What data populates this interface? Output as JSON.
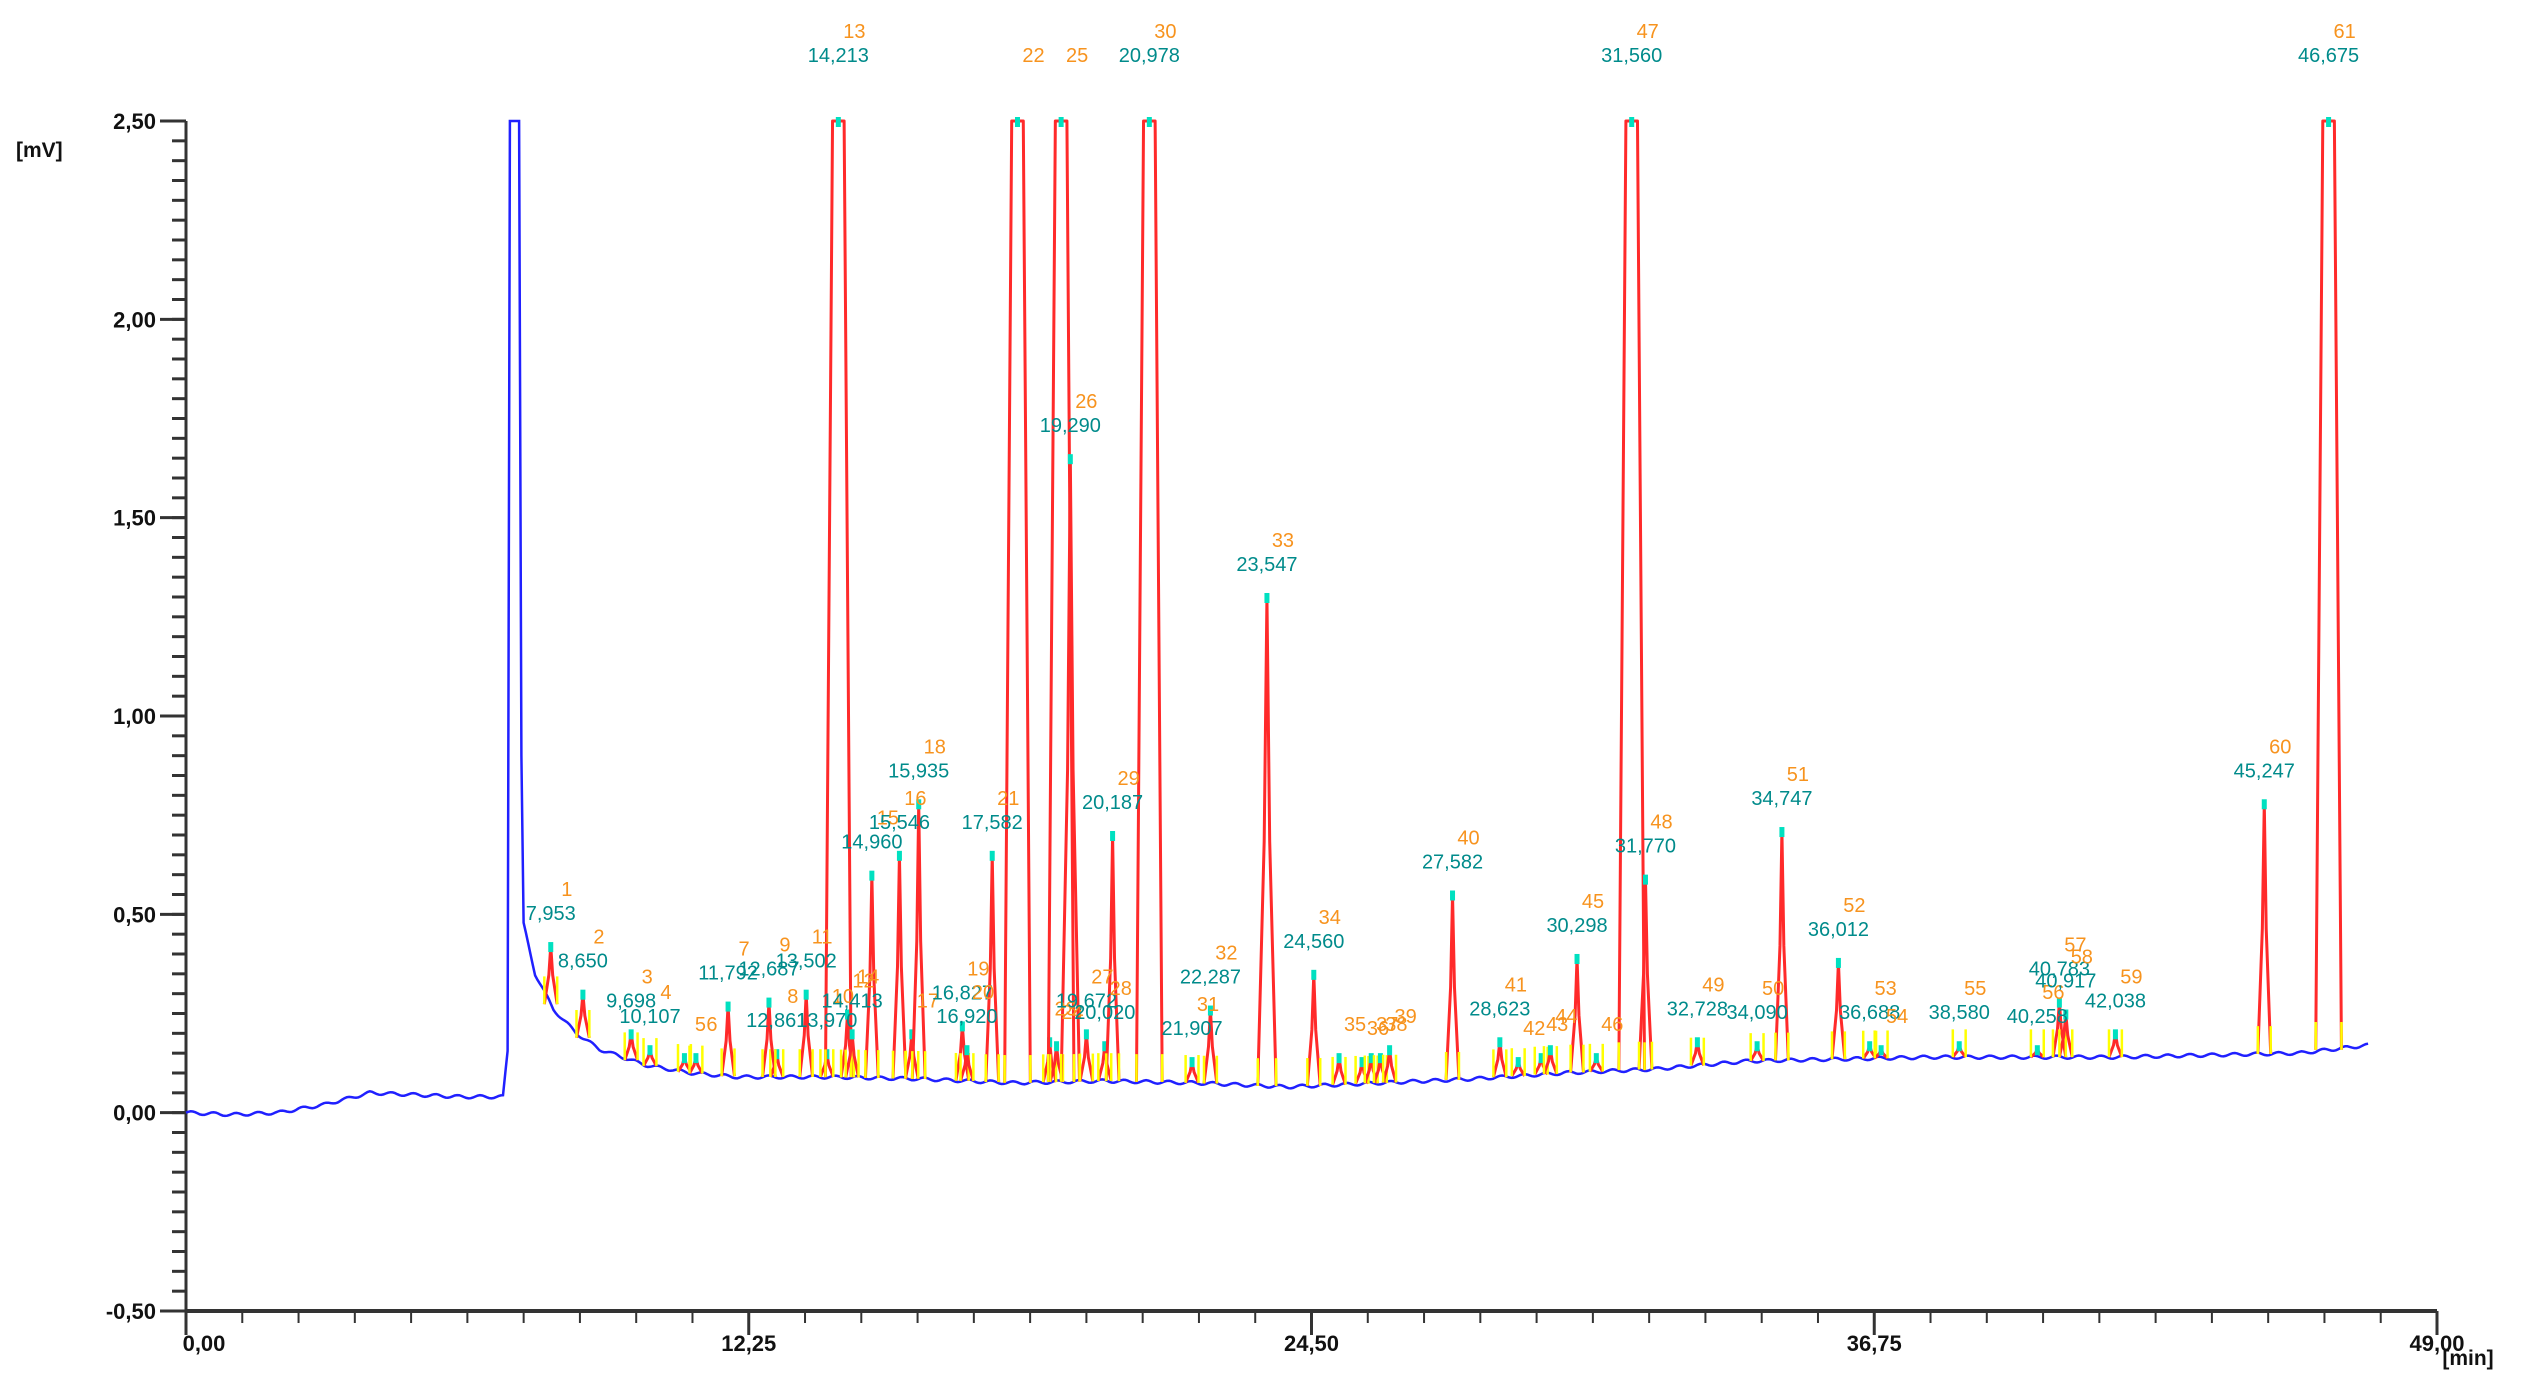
{
  "chart_data": {
    "type": "line",
    "title": "",
    "xlabel": "[min]",
    "ylabel": "[mV]",
    "xlim": [
      0,
      49
    ],
    "ylim": [
      -0.5,
      2.5
    ],
    "x_ticks": [
      0,
      12.25,
      24.5,
      36.75,
      49
    ],
    "x_tick_labels": [
      "0,00",
      "12,25",
      "24,50",
      "36,75",
      "49,00"
    ],
    "y_ticks": [
      2.5,
      2.0,
      1.5,
      1.0,
      0.5,
      0.0,
      -0.5
    ],
    "y_tick_labels": [
      "2,50",
      "2,00",
      "1,50",
      "1,00",
      "0,50",
      "0,00",
      "-0,50"
    ],
    "grid": false,
    "colors": {
      "baseline": "#2020ff",
      "peak": "#ff2a2a",
      "marker": "#ffff00",
      "apex": "#00e0c0",
      "number": "#f7931e",
      "rt": "#008b8b",
      "axis": "#333333"
    },
    "solvent_front": {
      "start": 7.0,
      "end": 7.27,
      "height": 2.5
    },
    "baseline": [
      [
        0,
        0.0
      ],
      [
        1,
        -0.005
      ],
      [
        2,
        0.0
      ],
      [
        3,
        0.02
      ],
      [
        4,
        0.05
      ],
      [
        5,
        0.045
      ],
      [
        6,
        0.04
      ],
      [
        6.9,
        0.04
      ],
      [
        7.3,
        0.5
      ],
      [
        7.6,
        0.35
      ],
      [
        8,
        0.26
      ],
      [
        8.5,
        0.2
      ],
      [
        9,
        0.16
      ],
      [
        10,
        0.12
      ],
      [
        11,
        0.1
      ],
      [
        12,
        0.09
      ],
      [
        14,
        0.09
      ],
      [
        16,
        0.085
      ],
      [
        18,
        0.075
      ],
      [
        20,
        0.08
      ],
      [
        22,
        0.075
      ],
      [
        24,
        0.065
      ],
      [
        26,
        0.075
      ],
      [
        28,
        0.085
      ],
      [
        30,
        0.1
      ],
      [
        32,
        0.11
      ],
      [
        34,
        0.13
      ],
      [
        36,
        0.135
      ],
      [
        38,
        0.14
      ],
      [
        40,
        0.14
      ],
      [
        42,
        0.14
      ],
      [
        44,
        0.145
      ],
      [
        46,
        0.15
      ],
      [
        47.5,
        0.17
      ]
    ],
    "peaks": [
      {
        "n": "1",
        "rt": "7,953",
        "t": 7.94,
        "h": 0.42
      },
      {
        "n": "2",
        "rt": "8,650",
        "t": 8.64,
        "h": 0.3
      },
      {
        "n": "3",
        "rt": "9,698",
        "t": 9.69,
        "h": 0.2
      },
      {
        "n": "4",
        "rt": "10,107",
        "t": 10.1,
        "h": 0.16
      },
      {
        "n": "5",
        "rt": "",
        "t": 10.85,
        "h": 0.14
      },
      {
        "n": "6",
        "rt": "",
        "t": 11.1,
        "h": 0.14
      },
      {
        "n": "7",
        "rt": "11,792",
        "t": 11.8,
        "h": 0.27
      },
      {
        "n": "8",
        "rt": "12,861",
        "t": 12.86,
        "h": 0.15
      },
      {
        "n": "9",
        "rt": "12,687",
        "t": 12.69,
        "h": 0.28
      },
      {
        "n": "10",
        "rt": "13,970",
        "t": 13.95,
        "h": 0.15
      },
      {
        "n": "11",
        "rt": "13,502",
        "t": 13.5,
        "h": 0.3
      },
      {
        "n": "12",
        "rt": "",
        "t": 14.4,
        "h": 0.25
      },
      {
        "n": "13",
        "rt": "14,213",
        "t": 14.2,
        "h": 2.5
      },
      {
        "n": "14",
        "rt": "14,413",
        "t": 14.5,
        "h": 0.2
      },
      {
        "n": "15",
        "rt": "14,960",
        "t": 14.93,
        "h": 0.6
      },
      {
        "n": "16",
        "rt": "15,546",
        "t": 15.53,
        "h": 0.65
      },
      {
        "n": "17",
        "rt": "",
        "t": 15.8,
        "h": 0.2
      },
      {
        "n": "18",
        "rt": "15,935",
        "t": 15.95,
        "h": 0.78
      },
      {
        "n": "19",
        "rt": "16,827",
        "t": 16.9,
        "h": 0.22
      },
      {
        "n": "20",
        "rt": "16,920",
        "t": 17.0,
        "h": 0.16
      },
      {
        "n": "21",
        "rt": "17,582",
        "t": 17.55,
        "h": 0.65
      },
      {
        "n": "22",
        "rt": "",
        "t": 18.1,
        "h": 2.5
      },
      {
        "n": "23",
        "rt": "",
        "t": 18.8,
        "h": 0.18
      },
      {
        "n": "24",
        "rt": "",
        "t": 18.95,
        "h": 0.17
      },
      {
        "n": "25",
        "rt": "",
        "t": 19.05,
        "h": 2.5
      },
      {
        "n": "26",
        "rt": "19,290",
        "t": 19.25,
        "h": 1.65
      },
      {
        "n": "27",
        "rt": "19,672",
        "t": 19.6,
        "h": 0.2
      },
      {
        "n": "28",
        "rt": "20,020",
        "t": 20.0,
        "h": 0.17
      },
      {
        "n": "29",
        "rt": "20,187",
        "t": 20.17,
        "h": 0.7
      },
      {
        "n": "30",
        "rt": "20,978",
        "t": 20.97,
        "h": 2.5
      },
      {
        "n": "31",
        "rt": "21,907",
        "t": 21.9,
        "h": 0.13
      },
      {
        "n": "32",
        "rt": "22,287",
        "t": 22.3,
        "h": 0.26
      },
      {
        "n": "33",
        "rt": "23,547",
        "t": 23.53,
        "h": 1.3
      },
      {
        "n": "34",
        "rt": "24,560",
        "t": 24.55,
        "h": 0.35
      },
      {
        "n": "35",
        "rt": "",
        "t": 25.1,
        "h": 0.14
      },
      {
        "n": "36",
        "rt": "",
        "t": 25.6,
        "h": 0.13
      },
      {
        "n": "37",
        "rt": "",
        "t": 25.8,
        "h": 0.14
      },
      {
        "n": "38",
        "rt": "",
        "t": 26.0,
        "h": 0.14
      },
      {
        "n": "39",
        "rt": "",
        "t": 26.2,
        "h": 0.16
      },
      {
        "n": "40",
        "rt": "27,582",
        "t": 27.57,
        "h": 0.55
      },
      {
        "n": "41",
        "rt": "28,623",
        "t": 28.6,
        "h": 0.18
      },
      {
        "n": "42",
        "rt": "",
        "t": 29.0,
        "h": 0.13
      },
      {
        "n": "43",
        "rt": "",
        "t": 29.5,
        "h": 0.14
      },
      {
        "n": "44",
        "rt": "",
        "t": 29.7,
        "h": 0.16
      },
      {
        "n": "45",
        "rt": "30,298",
        "t": 30.28,
        "h": 0.39
      },
      {
        "n": "46",
        "rt": "",
        "t": 30.7,
        "h": 0.14
      },
      {
        "n": "47",
        "rt": "31,560",
        "t": 31.47,
        "h": 2.5
      },
      {
        "n": "48",
        "rt": "31,770",
        "t": 31.77,
        "h": 0.59
      },
      {
        "n": "49",
        "rt": "32,728",
        "t": 32.9,
        "h": 0.18
      },
      {
        "n": "50",
        "rt": "34,090",
        "t": 34.2,
        "h": 0.17
      },
      {
        "n": "51",
        "rt": "34,747",
        "t": 34.74,
        "h": 0.71
      },
      {
        "n": "52",
        "rt": "36,012",
        "t": 35.97,
        "h": 0.38
      },
      {
        "n": "53",
        "rt": "36,688",
        "t": 36.65,
        "h": 0.17
      },
      {
        "n": "54",
        "rt": "",
        "t": 36.9,
        "h": 0.16
      },
      {
        "n": "55",
        "rt": "38,580",
        "t": 38.6,
        "h": 0.17
      },
      {
        "n": "56",
        "rt": "40,258",
        "t": 40.3,
        "h": 0.16
      },
      {
        "n": "57",
        "rt": "40,783",
        "t": 40.78,
        "h": 0.28
      },
      {
        "n": "58",
        "rt": "40,917",
        "t": 40.92,
        "h": 0.25
      },
      {
        "n": "59",
        "rt": "42,038",
        "t": 42.0,
        "h": 0.2
      },
      {
        "n": "60",
        "rt": "45,247",
        "t": 45.24,
        "h": 0.78
      },
      {
        "n": "61",
        "rt": "46,675",
        "t": 46.64,
        "h": 2.5
      }
    ]
  }
}
